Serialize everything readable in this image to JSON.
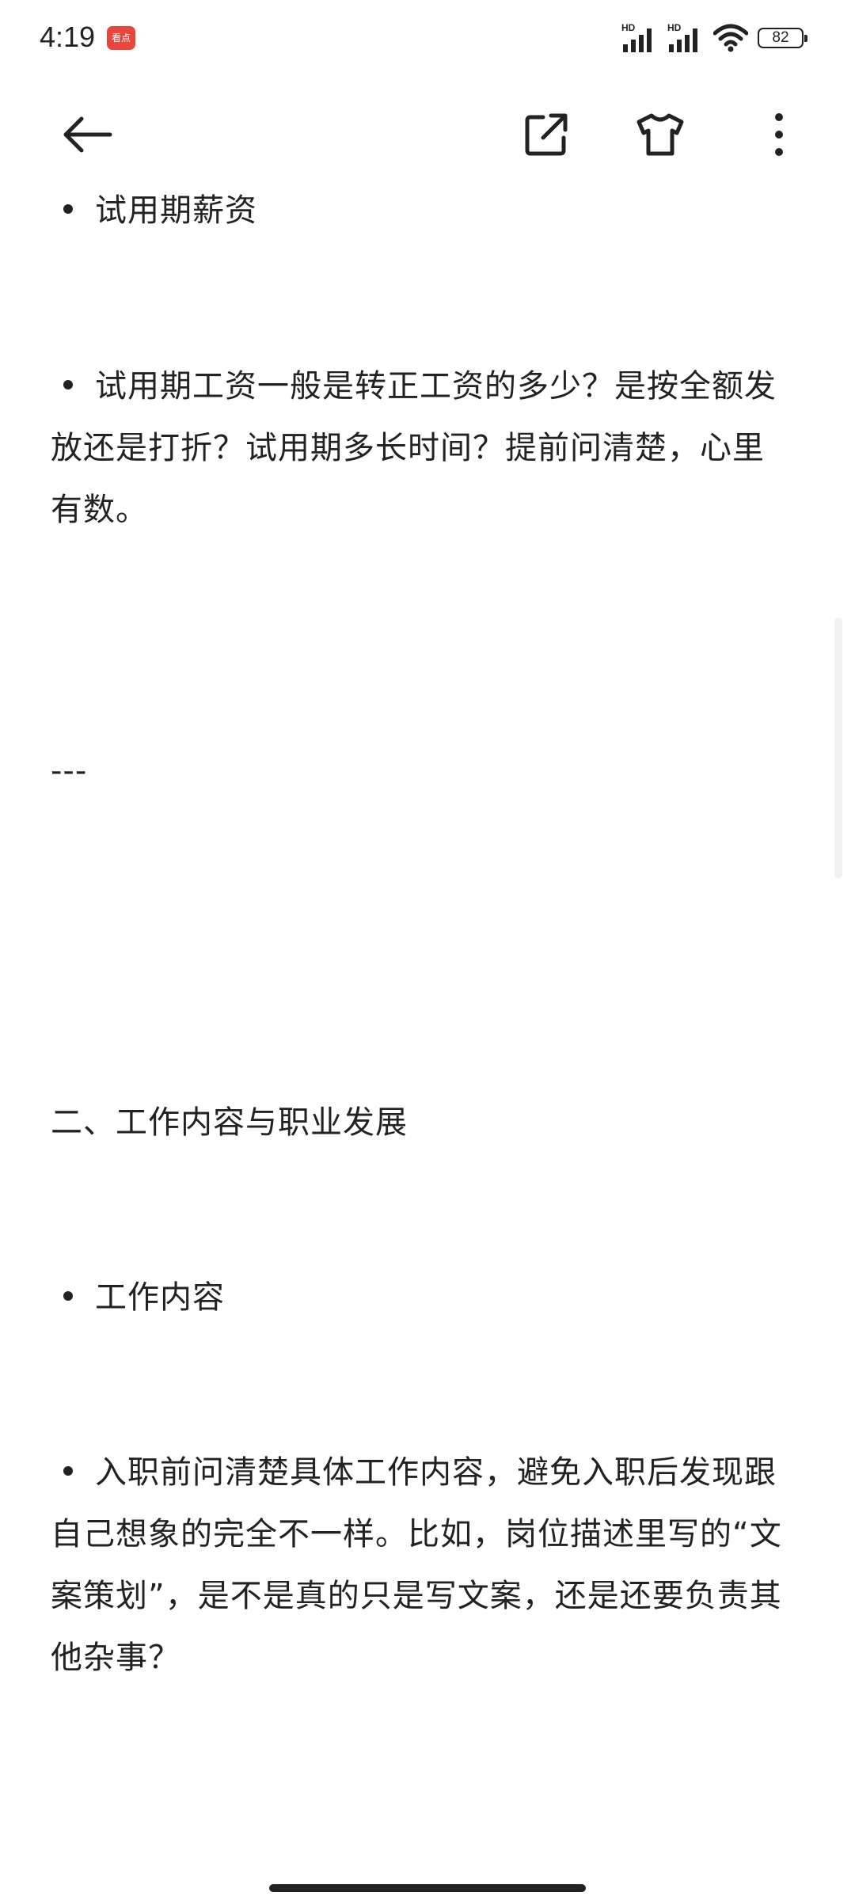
{
  "status": {
    "time": "4:19",
    "app_badge": "看点",
    "sim1_label": "HD",
    "sim2_label": "HD",
    "battery": "82"
  },
  "toolbar": {
    "back_icon": "arrow-left-icon",
    "share_icon": "share-external-icon",
    "theme_icon": "tshirt-icon",
    "more_icon": "more-vertical-icon"
  },
  "article": {
    "bullet_1": "试用期薪资",
    "bullet_2_line1": "试用期工资一般是转正工资的多少？是按全额发",
    "bullet_2_line2": "放还是打折？试用期多长时间？提前问清楚，心里",
    "bullet_2_line3": "有数。",
    "separator": "---",
    "section_heading": "二、工作内容与职业发展",
    "bullet_3": "工作内容",
    "bullet_4_line1": "入职前问清楚具体工作内容，避免入职后发现跟",
    "bullet_4_line2": "自己想象的完全不一样。比如，岗位描述里写的“文",
    "bullet_4_line3": "案策划”，是不是真的只是写文案，还是还要负责其",
    "bullet_4_line4": "他杂事？"
  },
  "colors": {
    "text": "#222222",
    "background": "#ffffff",
    "badge": "#e8453c"
  }
}
